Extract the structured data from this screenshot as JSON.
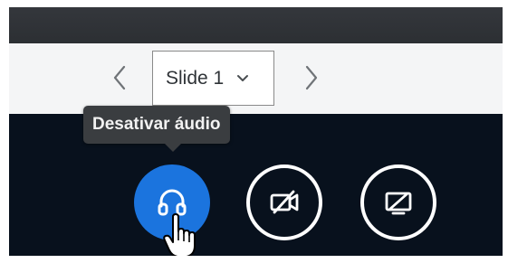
{
  "slide_nav": {
    "current_slide": "Slide 1",
    "prev_icon": "chevron-left-icon",
    "next_icon": "chevron-right-icon",
    "dropdown_icon": "chevron-down-icon"
  },
  "tooltip": {
    "text": "Desativar áudio"
  },
  "controls": [
    {
      "id": "audio",
      "icon": "headphones-icon",
      "active": true,
      "color": "#1b74de"
    },
    {
      "id": "video",
      "icon": "video-off-icon",
      "active": false,
      "color": "#ffffff"
    },
    {
      "id": "screen",
      "icon": "screen-share-off-icon",
      "active": false,
      "color": "#ffffff"
    }
  ],
  "colors": {
    "control_bar_bg": "#08111d",
    "nav_bar_bg": "#f4f5f6",
    "accent": "#1b74de",
    "tooltip_bg": "#3a3d40"
  }
}
